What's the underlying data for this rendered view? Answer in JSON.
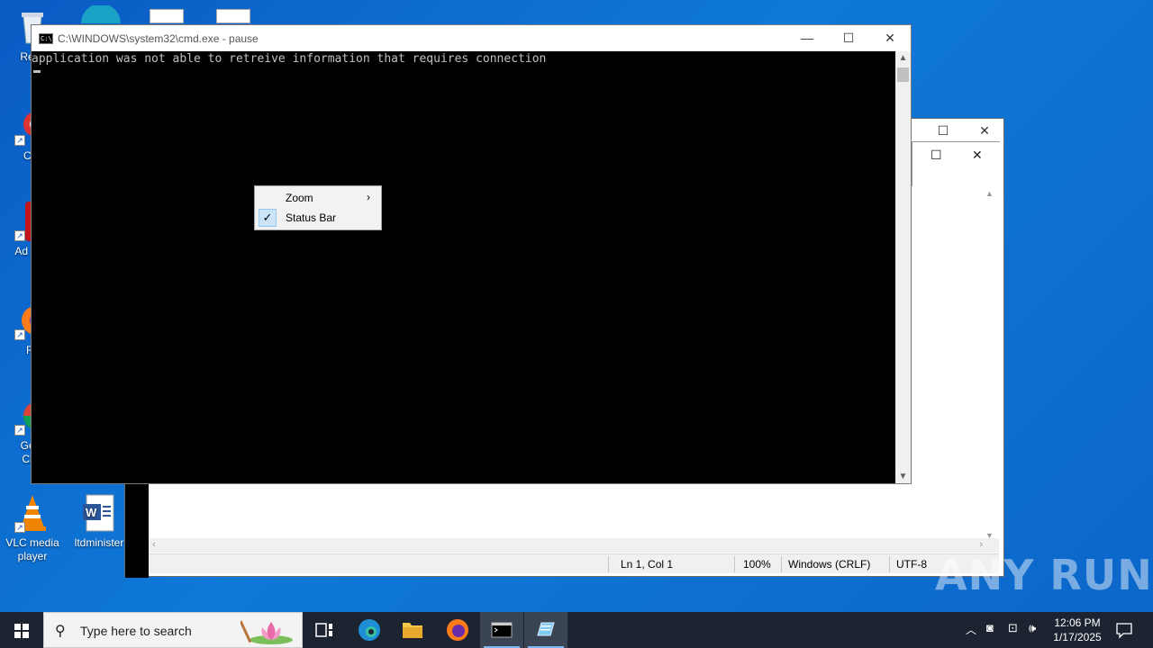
{
  "desktop": {
    "icons": [
      {
        "label": "Recy"
      },
      {
        "label": "CCl"
      },
      {
        "label": "Ad Acr"
      },
      {
        "label": "Fir"
      },
      {
        "label": "Goo Chr"
      },
      {
        "label": "VLC media player"
      },
      {
        "label": "ltdminister"
      }
    ]
  },
  "cmd": {
    "title": "C:\\WINDOWS\\system32\\cmd.exe - pause",
    "output_line": "application was not able to retreive information that requires connection",
    "minimize": "—",
    "maximize": "☐",
    "close": "✕"
  },
  "context_menu": {
    "items": [
      {
        "label": "Zoom",
        "arrow": "›"
      },
      {
        "label": "Status Bar",
        "check": "✓"
      }
    ]
  },
  "notepad": {
    "status": {
      "position": "Ln 1, Col 1",
      "zoom": "100%",
      "line_endings": "Windows (CRLF)",
      "encoding": "UTF-8"
    }
  },
  "watermark": "ANY RUN",
  "taskbar": {
    "search_placeholder": "Type here to search",
    "time": "12:06 PM",
    "date": "1/17/2025"
  },
  "colors": {
    "desktop": "#0f79d8",
    "taskbar": "#1c2432",
    "check_bg": "#cce4f7"
  }
}
